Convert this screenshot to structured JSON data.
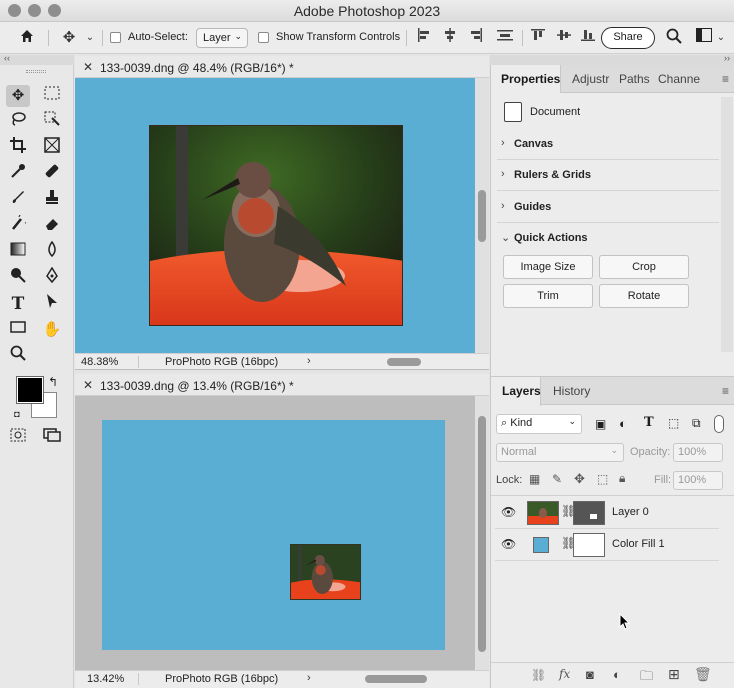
{
  "app": {
    "title": "Adobe Photoshop 2023"
  },
  "options_bar": {
    "auto_select_label": "Auto-Select:",
    "auto_select_value": "Layer",
    "transform_label": "Show Transform Controls",
    "share_label": "Share"
  },
  "documents": [
    {
      "tab_title": "133-0039.dng @ 48.4% (RGB/16*) *",
      "zoom": "48.38%",
      "profile": "ProPhoto RGB (16bpc)"
    },
    {
      "tab_title": "133-0039.dng @ 13.4% (RGB/16*) *",
      "zoom": "13.42%",
      "profile": "ProPhoto RGB (16bpc)"
    }
  ],
  "properties_panel": {
    "tabs": [
      "Properties",
      "Adjustr",
      "Paths",
      "Channe"
    ],
    "doc_label": "Document",
    "sections": [
      "Canvas",
      "Rulers & Grids",
      "Guides",
      "Quick Actions"
    ],
    "quick_actions": [
      "Image Size",
      "Crop",
      "Trim",
      "Rotate"
    ]
  },
  "layers_panel": {
    "tabs": [
      "Layers",
      "History"
    ],
    "filter_value": "Kind",
    "blend_mode": "Normal",
    "opacity_label": "Opacity:",
    "opacity_value": "100%",
    "lock_label": "Lock:",
    "fill_label": "Fill:",
    "fill_value": "100%",
    "layers": [
      {
        "name": "Layer 0"
      },
      {
        "name": "Color Fill 1"
      }
    ]
  },
  "colors": {
    "canvas_blue": "#5aaed4",
    "panel_bg": "#ececec",
    "feeder_red": "#e8421c"
  }
}
